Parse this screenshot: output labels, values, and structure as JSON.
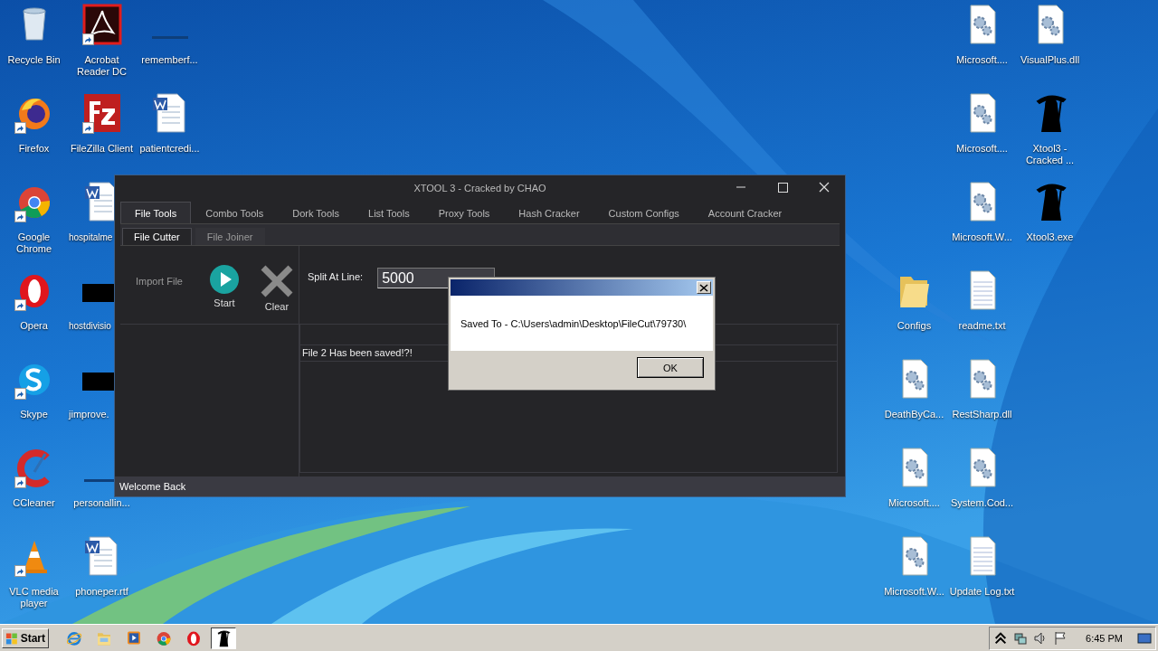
{
  "desktop": {
    "left_columns": [
      [
        {
          "label": "Recycle Bin",
          "kind": "recycle",
          "shortcut": false
        },
        {
          "label": "Firefox",
          "kind": "firefox",
          "shortcut": true
        },
        {
          "label": "Google Chrome",
          "kind": "chrome",
          "shortcut": true
        },
        {
          "label": "Opera",
          "kind": "opera",
          "shortcut": true
        },
        {
          "label": "Skype",
          "kind": "skype",
          "shortcut": true
        },
        {
          "label": "CCleaner",
          "kind": "ccleaner",
          "shortcut": true
        },
        {
          "label": "VLC media player",
          "kind": "vlc",
          "shortcut": true
        }
      ],
      [
        {
          "label": "Acrobat Reader DC",
          "kind": "acrobat",
          "shortcut": true
        },
        {
          "label": "FileZilla Client",
          "kind": "filezilla",
          "shortcut": true
        },
        {
          "label": "hospitalme",
          "kind": "word",
          "shortcut": false
        },
        {
          "label": "hostdivisio",
          "kind": "bar",
          "shortcut": false
        },
        {
          "label": "jimprove.",
          "kind": "bar",
          "shortcut": false
        },
        {
          "label": "personallin...",
          "kind": "line",
          "shortcut": false
        },
        {
          "label": "phoneper.rtf",
          "kind": "word",
          "shortcut": false
        }
      ],
      [
        {
          "label": "rememberf...",
          "kind": "line",
          "shortcut": false
        },
        {
          "label": "patientcredi...",
          "kind": "word",
          "shortcut": false
        }
      ]
    ],
    "right_columns": [
      [
        {
          "label": "Configs",
          "kind": "folder",
          "shortcut": false
        },
        {
          "label": "DeathByCa...",
          "kind": "dll",
          "shortcut": false
        },
        {
          "label": "Microsoft....",
          "kind": "dll",
          "shortcut": false
        },
        {
          "label": "Microsoft.W...",
          "kind": "dll",
          "shortcut": false
        }
      ],
      [
        {
          "label": "Microsoft....",
          "kind": "dll",
          "shortcut": false
        },
        {
          "label": "Microsoft....",
          "kind": "dll",
          "shortcut": false
        },
        {
          "label": "Microsoft.W...",
          "kind": "dll",
          "shortcut": false
        },
        {
          "label": "readme.txt",
          "kind": "text",
          "shortcut": false
        },
        {
          "label": "RestSharp.dll",
          "kind": "dll",
          "shortcut": false
        },
        {
          "label": "System.Cod...",
          "kind": "dll",
          "shortcut": false
        },
        {
          "label": "Update Log.txt",
          "kind": "text",
          "shortcut": false
        }
      ],
      [
        {
          "label": "VisualPlus.dll",
          "kind": "dll",
          "shortcut": false
        },
        {
          "label": "Xtool3 - Cracked ...",
          "kind": "reaper",
          "shortcut": false
        },
        {
          "label": "Xtool3.exe",
          "kind": "reaper",
          "shortcut": false
        }
      ]
    ]
  },
  "window": {
    "title": "XTOOL 3 - Cracked by CHAO",
    "tabs": [
      {
        "label": "File Tools",
        "selected": true
      },
      {
        "label": "Combo Tools",
        "selected": false
      },
      {
        "label": "Dork Tools",
        "selected": false
      },
      {
        "label": "List Tools",
        "selected": false
      },
      {
        "label": "Proxy Tools",
        "selected": false
      },
      {
        "label": "Hash Cracker",
        "selected": false
      },
      {
        "label": "Custom Configs",
        "selected": false
      },
      {
        "label": "Account Cracker",
        "selected": false
      }
    ],
    "subtabs": [
      {
        "label": "File Cutter",
        "selected": true
      },
      {
        "label": "File Joiner",
        "selected": false
      }
    ],
    "actions": [
      {
        "label": "Import File",
        "kind": "text"
      },
      {
        "label": "Start",
        "kind": "play"
      },
      {
        "label": "Clear",
        "kind": "clear"
      }
    ],
    "split_label": "Split At Line:",
    "split_value": "5000",
    "log_rows": [
      "File 2 Has been saved!?!"
    ],
    "status_bar": "Welcome Back"
  },
  "dialog": {
    "message": "Saved To - C:\\Users\\admin\\Desktop\\FileCut\\79730\\",
    "button": "OK"
  },
  "taskbar": {
    "start": "Start",
    "apps": [
      {
        "kind": "ie",
        "selected": false
      },
      {
        "kind": "explorer",
        "selected": false
      },
      {
        "kind": "media",
        "selected": false
      },
      {
        "kind": "chrome",
        "selected": false
      },
      {
        "kind": "opera",
        "selected": false
      },
      {
        "kind": "reaper",
        "selected": true
      }
    ],
    "clock": "6:45 PM"
  }
}
